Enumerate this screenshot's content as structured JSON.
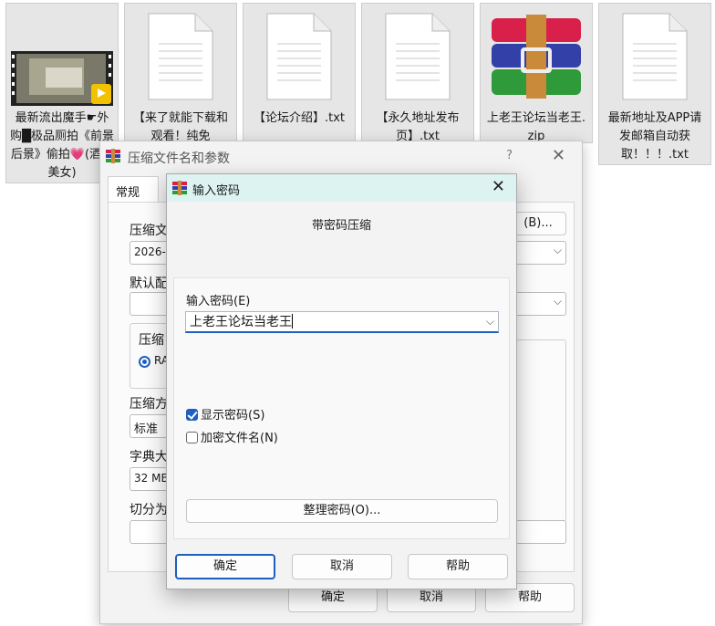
{
  "files": [
    {
      "name": "最新流出魔手☛外购█极品厕拍《前景后景》偷拍💗(酒吧美女)",
      "type": "video"
    },
    {
      "name": "【来了就能下载和观看！纯免",
      "type": "text"
    },
    {
      "name": "【论坛介绍】.txt",
      "type": "text"
    },
    {
      "name": "【永久地址发布页】.txt",
      "type": "text"
    },
    {
      "name": "上老王论坛当老王.zip",
      "type": "archive"
    },
    {
      "name": "最新地址及APP请发邮箱自动获取！！！.txt",
      "type": "text"
    }
  ],
  "video_badge": "Player",
  "parent_dialog": {
    "title": "压缩文件名和参数",
    "help": "?",
    "close": "✕",
    "tab_general": "常规",
    "label_archive_name": "压缩文",
    "archive_name_value": "2026-2",
    "browse_button": "(B)...",
    "label_default_profile": "默认配",
    "label_format": "压缩",
    "format_radio": "RA",
    "label_method": "压缩方",
    "method_value": "标准",
    "label_dict": "字典大",
    "dict_value": "32 MB",
    "label_split": "切分为",
    "ok": "确定",
    "cancel": "取消",
    "help_button": "帮助"
  },
  "password_dialog": {
    "title": "输入密码",
    "heading": "带密码压缩",
    "label_enter_password": "输入密码(E)",
    "password_value": "上老王论坛当老王",
    "show_password_label": "显示密码(S)",
    "show_password_checked": true,
    "encrypt_names_label": "加密文件名(N)",
    "encrypt_names_checked": false,
    "organize_button": "整理密码(O)...",
    "ok": "确定",
    "cancel": "取消",
    "help": "帮助"
  },
  "colors": {
    "accent": "#1f5fbf",
    "title_bar": "#dcf3f1",
    "dialog_bg": "#f3f3f3"
  }
}
